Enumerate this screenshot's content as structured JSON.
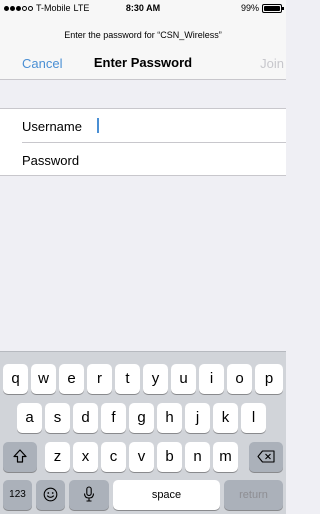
{
  "status_bar": {
    "carrier": "T-Mobile",
    "network": "LTE",
    "time": "8:30 AM",
    "battery": "99%",
    "battery_level": 0.99
  },
  "nav": {
    "prompt": "Enter the password for “CSN_Wireless”",
    "cancel_label": "Cancel",
    "title": "Enter Password",
    "join_label": "Join"
  },
  "form": {
    "username_label": "Username",
    "password_label": "Password"
  },
  "keyboard": {
    "row1": [
      "q",
      "w",
      "e",
      "r",
      "t",
      "y",
      "u",
      "i",
      "o",
      "p"
    ],
    "row2": [
      "a",
      "s",
      "d",
      "f",
      "g",
      "h",
      "j",
      "k",
      "l"
    ],
    "row3": [
      "z",
      "x",
      "c",
      "v",
      "b",
      "n",
      "m"
    ],
    "numbers_label": "123",
    "space_label": "space",
    "return_label": "return"
  },
  "colors": {
    "accent": "#4a8fd4",
    "disabled": "#c7c7cc"
  }
}
